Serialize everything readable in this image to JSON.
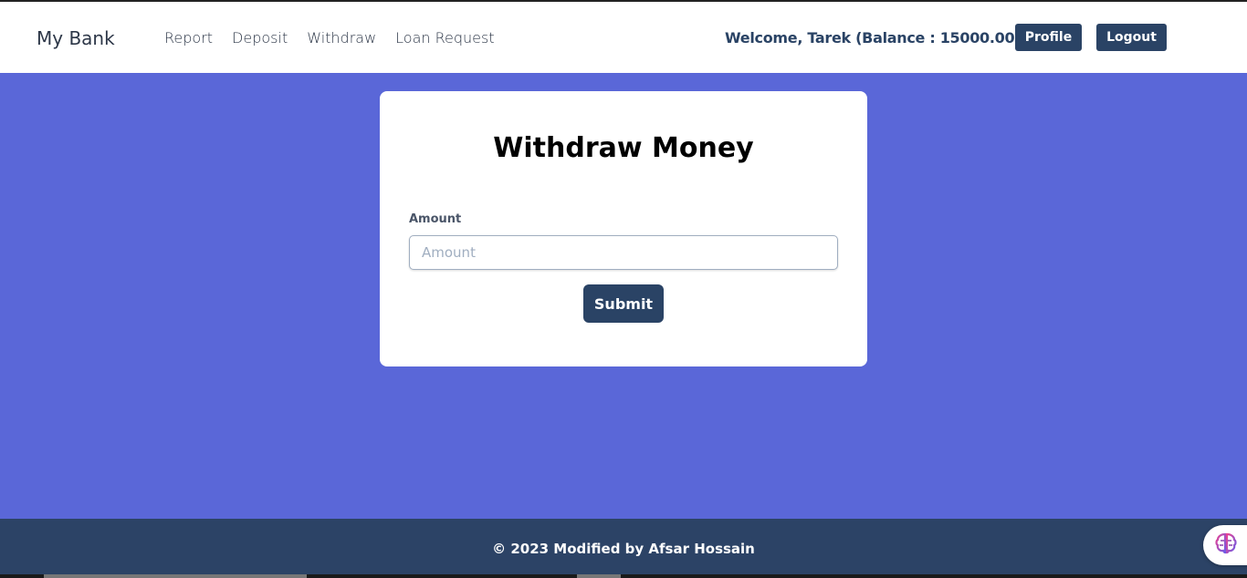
{
  "navbar": {
    "brand": "My Bank",
    "links": [
      "Report",
      "Deposit",
      "Withdraw",
      "Loan Request"
    ],
    "welcome": "Welcome, Tarek (Balance : 15000.00)",
    "profile_label": "Profile",
    "logout_label": "Logout"
  },
  "form": {
    "title": "Withdraw Money",
    "amount_label": "Amount",
    "amount_placeholder": "Amount",
    "amount_value": "",
    "submit_label": "Submit"
  },
  "footer": {
    "text": "© 2023 Modified by Afsar Hossain"
  },
  "widget": {
    "icon": "brain-icon"
  },
  "colors": {
    "page_background": "#5a67d8",
    "primary_button": "#2a4365",
    "footer_background": "#2c4366"
  }
}
